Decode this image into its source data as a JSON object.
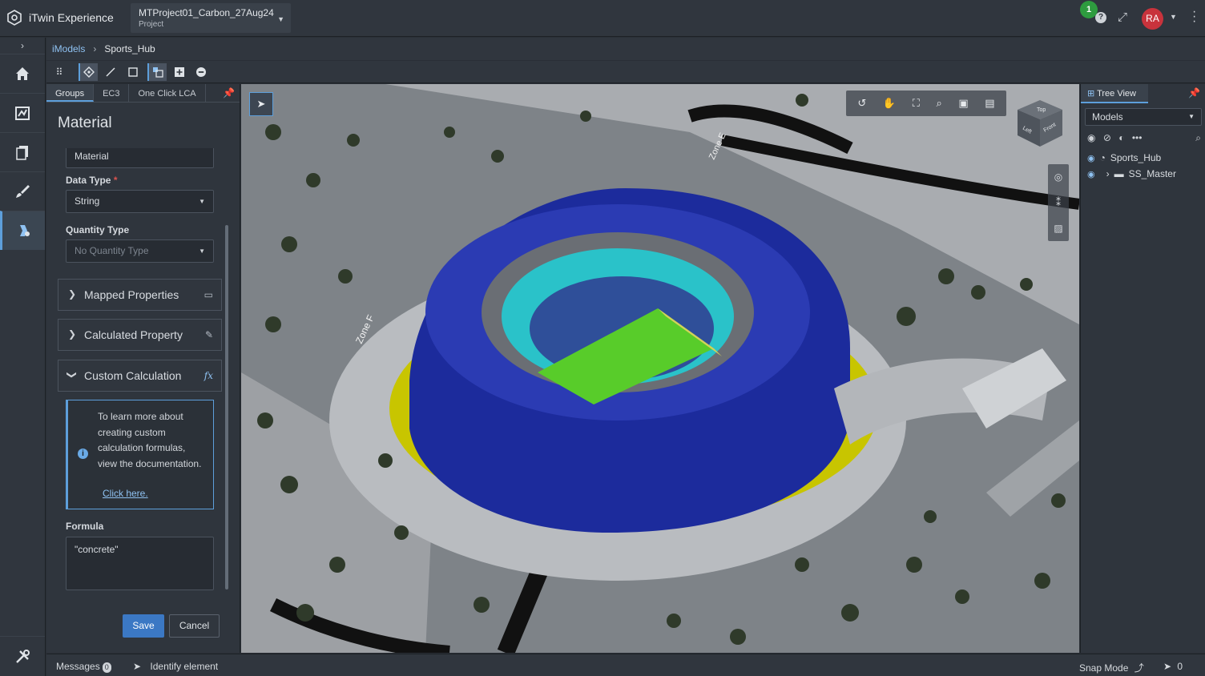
{
  "header": {
    "brand": "iTwin Experience",
    "project_name": "MTProject01_Carbon_27Aug24",
    "project_sub": "Project",
    "notification_count": "1",
    "avatar_initials": "RA"
  },
  "breadcrumb": {
    "link": "iModels",
    "current": "Sports_Hub"
  },
  "left_panel": {
    "tabs": [
      "Groups",
      "EC3",
      "One Click LCA"
    ],
    "title": "Material",
    "material_value": "Material",
    "data_type_label": "Data Type",
    "required_mark": "*",
    "data_type_value": "String",
    "quantity_type_label": "Quantity Type",
    "quantity_type_placeholder": "No Quantity Type",
    "accordions": {
      "mapped": "Mapped Properties",
      "calculated": "Calculated Property",
      "custom": "Custom Calculation"
    },
    "info_text": "To learn more about creating custom calculation formulas, view the documentation.",
    "info_link": "Click here.",
    "formula_label": "Formula",
    "formula_value": "\"concrete\"",
    "save": "Save",
    "cancel": "Cancel"
  },
  "viewport": {
    "cube_faces": {
      "top": "Top",
      "left": "Left",
      "front": "Front"
    },
    "zone_labels": [
      "Zone F",
      "Zone E"
    ]
  },
  "right_panel": {
    "tab": "Tree View",
    "models_select": "Models",
    "tree": [
      "Sports_Hub",
      "SS_Master"
    ]
  },
  "status_bar": {
    "messages": "Messages",
    "messages_count": "0",
    "identify": "Identify element",
    "snap_mode": "Snap Mode",
    "selection_count": "0"
  },
  "colors": {
    "accent": "#5d9fdb",
    "primary_button": "#3b78c4",
    "avatar": "#c8333c",
    "notification": "#2e9b3f"
  }
}
